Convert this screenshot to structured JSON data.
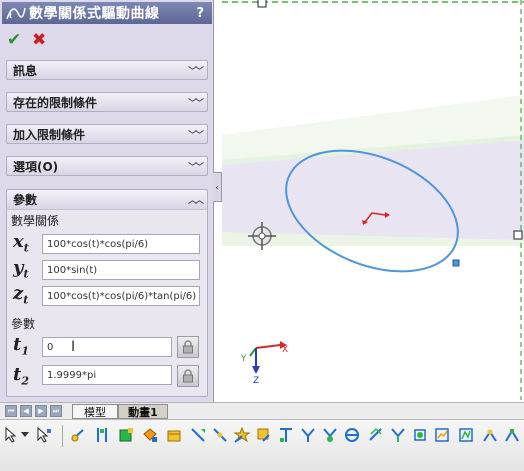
{
  "panel": {
    "title": "數學關係式驅動曲線",
    "help_label": "?",
    "ok_label": "✔",
    "cancel_label": "✖",
    "groups": [
      {
        "label": "訊息"
      },
      {
        "label": "存在的限制條件"
      },
      {
        "label": "加入限制條件"
      },
      {
        "label": "選項(O)"
      }
    ],
    "params_group": {
      "label": "參數",
      "equation_label": "數學關係",
      "param_label": "參數",
      "equations": [
        {
          "var": "x",
          "sub": "t",
          "value": "100*cos(t)*cos(pi/6)"
        },
        {
          "var": "y",
          "sub": "t",
          "value": "100*sin(t)"
        },
        {
          "var": "z",
          "sub": "t",
          "value": "100*cos(t)*cos(pi/6)*tan(pi/6)"
        }
      ],
      "params": [
        {
          "var": "t",
          "sub": "1",
          "value": "0"
        },
        {
          "var": "t",
          "sub": "2",
          "value": "1.9999*pi"
        }
      ]
    }
  },
  "tabs": {
    "model": "模型",
    "motion": "動畫1"
  },
  "triad": {
    "x": "X",
    "y": "Y",
    "z": "Z"
  },
  "colors": {
    "panel_bg": "#ddd8ea",
    "title_bar": "#5d6796",
    "curve": "#4f95d9",
    "ok": "#1f9a2a",
    "cancel": "#cc1e1e"
  },
  "toolbar_icons": [
    "select-arrow-icon",
    "dropdown-chevron-icon",
    "smart-select-icon",
    "point-icon",
    "vertical-line-icon",
    "square-icon",
    "fix-icon",
    "box-icon",
    "dimension-icon",
    "midpoint-icon",
    "star-icon",
    "parallel-icon",
    "perpendicular-icon",
    "equal-icon",
    "merge-icon",
    "coincident-icon",
    "tangent-icon",
    "symmetric-icon",
    "collinear-icon",
    "concentric-icon",
    "horizontal-icon",
    "vertical-icon",
    "pierce-icon",
    "intersection-icon"
  ]
}
